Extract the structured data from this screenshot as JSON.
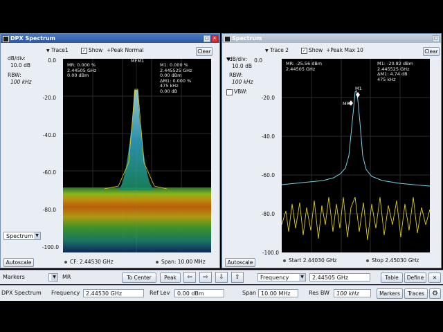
{
  "windows": [
    {
      "title": "DPX Spectrum",
      "trace_label": "Trace1",
      "show_label": "Show",
      "detection_label": "+Peak Normal",
      "clear_label": "Clear",
      "ref_value": "0.0",
      "dbdiv_label": "dB/div:",
      "dbdiv_value": "10.0 dB",
      "rbw_label": "RBW:",
      "rbw_value": "100 kHz",
      "y_ticks": [
        "0.0",
        "-20.0",
        "-40.0",
        "-60.0",
        "-80.0",
        "-100.0"
      ],
      "marker_top": "MFM1",
      "readout_left": [
        "MR: 0.000 %",
        "2.44505 GHz",
        "0.00 dBm"
      ],
      "readout_right": [
        "M1: 0.000 %",
        "2.445525 GHz",
        "0.00 dBm",
        "ΔM1: 0.000 %",
        "475 kHz",
        "0.00 dB"
      ],
      "mode_select": "Spectrum",
      "autoscale_label": "Autoscale",
      "footer_left": "CF:  2.44530 GHz",
      "footer_right": "Span:  10.00 MHz"
    },
    {
      "title": "Spectrum",
      "trace_label": "Trace 2",
      "show_label": "Show",
      "detection_label": "+Peak Max 10",
      "clear_label": "Clear",
      "ref_value": "0.0",
      "dbdiv_label": "dB/div:",
      "dbdiv_value": "10.0 dB",
      "rbw_label": "RBW:",
      "rbw_value": "100 kHz",
      "vbw_label": "VBW:",
      "y_ticks": [
        "-20.0",
        "-40.0",
        "-60.0",
        "-80.0",
        "-100.0"
      ],
      "marker_mr": "MR",
      "marker_m1": "M1",
      "readout_left": [
        "MR: -25.56 dBm",
        "2.44505 GHz"
      ],
      "readout_right": [
        "M1: -20.82 dBm",
        "2.445525 GHz",
        "ΔM1: 4.74 dB",
        "475 kHz"
      ],
      "autoscale_label": "Autoscale",
      "footer_left": "Start  2.44030 GHz",
      "footer_right": "Stop  2.45030 GHz"
    }
  ],
  "markers_bar": {
    "label": "Markers",
    "marker_select": "MR",
    "to_center": "To Center",
    "peak": "Peak",
    "arrow_left": "⇦",
    "arrow_right": "⇨",
    "arrow_down": "⇩",
    "arrow_up": "⇧",
    "readout_select": "Frequency",
    "readout_value": "2.44505 GHz",
    "table": "Table",
    "define": "Define",
    "close": "✕"
  },
  "settings_bar": {
    "display_name": "DPX Spectrum",
    "frequency_label": "Frequency",
    "frequency_value": "2.44530 GHz",
    "ref_lev_label": "Ref Lev",
    "ref_lev_value": "0.00 dBm",
    "span_label": "Span",
    "span_value": "10.00 MHz",
    "res_bw_label": "Res BW",
    "res_bw_value": "100 kHz",
    "markers_btn": "Markers",
    "traces_btn": "Traces"
  },
  "colors": {
    "trace_cyan": "#7fd3e6",
    "trace_yellow": "#e0d020",
    "title_active": "#2d58a6"
  },
  "icons": [
    "window-icon",
    "maximize-icon",
    "close-icon",
    "gear-icon",
    "checkbox-icon"
  ]
}
